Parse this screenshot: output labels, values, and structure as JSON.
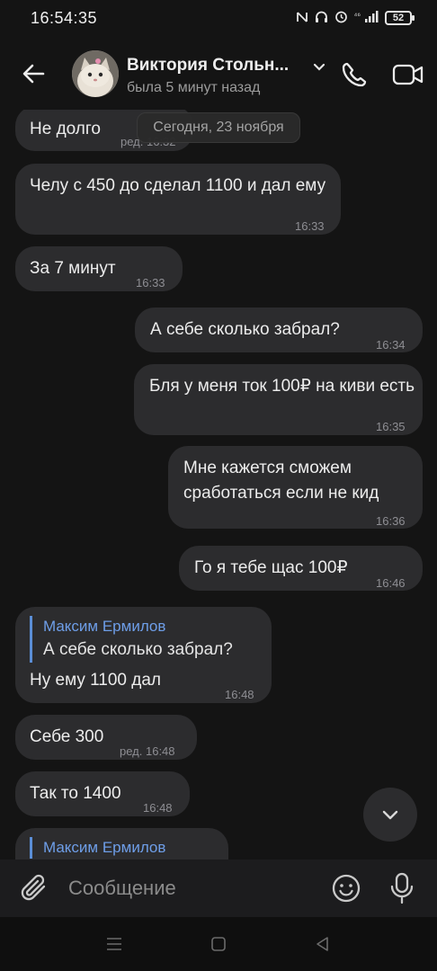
{
  "status": {
    "time": "16:54:35",
    "signal": "⁴⁶",
    "battery": "52"
  },
  "header": {
    "name": "Виктория Стольн...",
    "last_seen": "была 5 минут назад"
  },
  "date_divider": "Сегодня, 23 ноября",
  "messages": [
    {
      "text": "Не долго",
      "time": "ред. 16:32"
    },
    {
      "text": "Челу с 450 до сделал 1100 и дал ему",
      "time": "16:33"
    },
    {
      "text": "За 7 минут",
      "time": "16:33"
    },
    {
      "text": "А себе сколько забрал?",
      "time": "16:34"
    },
    {
      "text": "Бля у меня ток 100₽ на киви есть",
      "time": "16:35"
    },
    {
      "text": "Мне кажется сможем сработаться если не кид",
      "time": "16:36"
    },
    {
      "text": "Го я тебе щас 100₽",
      "time": "16:46"
    },
    {
      "reply_author": "Максим Ермилов",
      "reply_text": "А себе сколько забрал?",
      "text": "Ну ему 1100 дал",
      "time": "16:48"
    },
    {
      "text": "Себе 300",
      "time": "ред. 16:48"
    },
    {
      "text": "Так то 1400",
      "time": "16:48"
    },
    {
      "reply_author": "Максим Ермилов"
    }
  ],
  "composer": {
    "placeholder": "Сообщение"
  },
  "icons": {
    "back": "arrow-left-icon",
    "call": "phone-icon",
    "video": "video-camera-icon",
    "attach": "paperclip-icon",
    "emoji": "smiley-icon",
    "mic": "microphone-icon",
    "scroll": "chevron-down-icon"
  },
  "colors": {
    "background": "#141414",
    "bubble": "#2c2c2e",
    "accent": "#6e9ee8"
  }
}
